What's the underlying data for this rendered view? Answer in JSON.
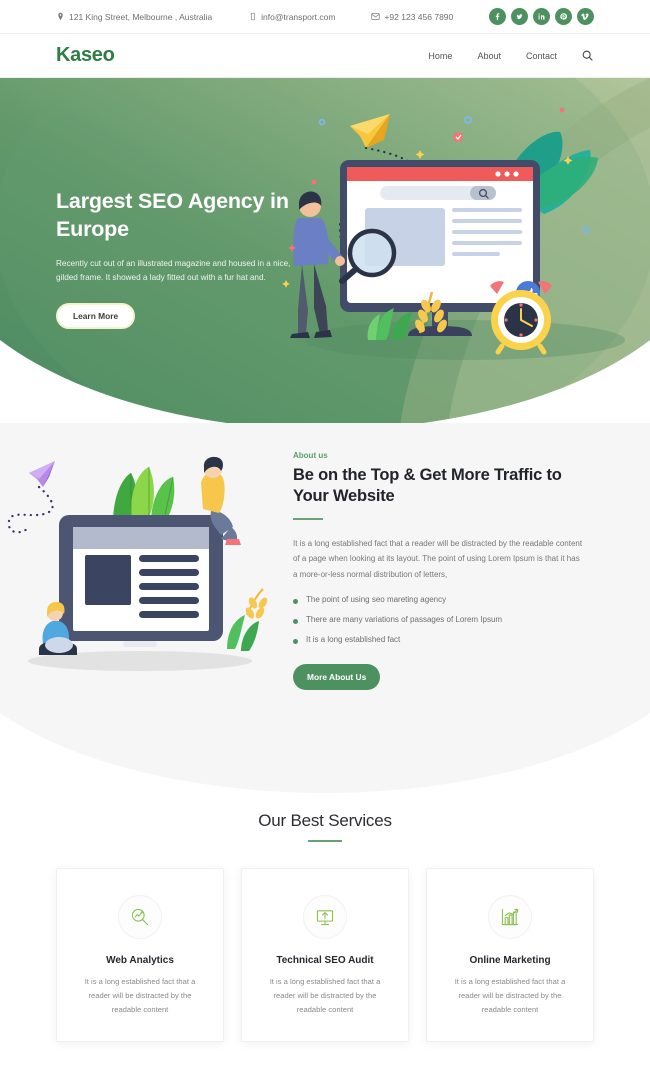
{
  "topbar": {
    "address": "121 King Street, Melbourne , Australia",
    "email": "info@transport.com",
    "phone": "+92 123 456 7890",
    "address_icon": "map-pin-icon",
    "email_icon": "mobile-icon",
    "phone_icon": "envelope-icon",
    "socials": [
      {
        "name": "facebook",
        "glyph": "f"
      },
      {
        "name": "twitter",
        "glyph": "t"
      },
      {
        "name": "linkedin",
        "glyph": "in"
      },
      {
        "name": "pinterest",
        "glyph": "p"
      },
      {
        "name": "vimeo",
        "glyph": "v"
      }
    ]
  },
  "header": {
    "logo": "Kaseo",
    "nav": [
      {
        "label": "Home"
      },
      {
        "label": "About"
      },
      {
        "label": "Contact"
      }
    ],
    "search_icon": "search-icon"
  },
  "hero": {
    "title": "Largest SEO Agency in Europe",
    "paragraph": "Recently cut out of an illustrated magazine and housed in a nice, gilded frame. It showed a lady fitted out with a fur hat and.",
    "cta": "Learn More",
    "illustration": "seo-desktop-illustration"
  },
  "about": {
    "eyebrow": "About us",
    "title": "Be on the Top & Get More Traffic to Your Website",
    "paragraph": "It is a long established fact that a reader will be distracted by the readable content of a page when looking at its layout. The point of using Lorem Ipsum is that it has a more-or-less normal distribution of letters,",
    "bullets": [
      "The point of using seo mareting agency",
      "There are many variations of passages of Lorem Ipsum",
      "It is a long established fact"
    ],
    "cta": "More About Us",
    "illustration": "laptop-people-illustration"
  },
  "services": {
    "title": "Our Best Services",
    "cards": [
      {
        "icon": "analytics-magnifier-icon",
        "title": "Web Analytics",
        "text": "It is a long established fact that a reader will be distracted by the readable content"
      },
      {
        "icon": "monitor-upload-icon",
        "title": "Technical SEO Audit",
        "text": "It is a long established fact that a reader will be distracted by the readable content"
      },
      {
        "icon": "bar-chart-growth-icon",
        "title": "Online Marketing",
        "text": "It is a long established fact that a reader will be distracted by the readable content"
      }
    ]
  },
  "colors": {
    "brand_green": "#4e9161",
    "logo_green": "#2f7d46",
    "hero_dark": "#4e8a62",
    "hero_light": "#a9bf93",
    "section_gray": "#f6f6f6",
    "icon_green": "#8cc152"
  }
}
